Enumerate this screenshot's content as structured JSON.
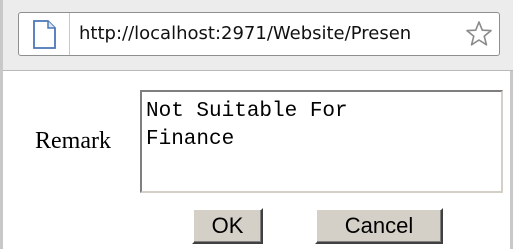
{
  "browser": {
    "address": "http://localhost:2971/Website/Presen",
    "page_icon": "page-icon",
    "bookmark_icon": "star-icon"
  },
  "form": {
    "remark_label": "Remark",
    "remark_value": "Not Suitable For\nFinance"
  },
  "buttons": {
    "ok_label": "OK",
    "cancel_label": "Cancel"
  },
  "colors": {
    "button_face": "#d4d0c8",
    "window_border": "#c8c8c8"
  }
}
